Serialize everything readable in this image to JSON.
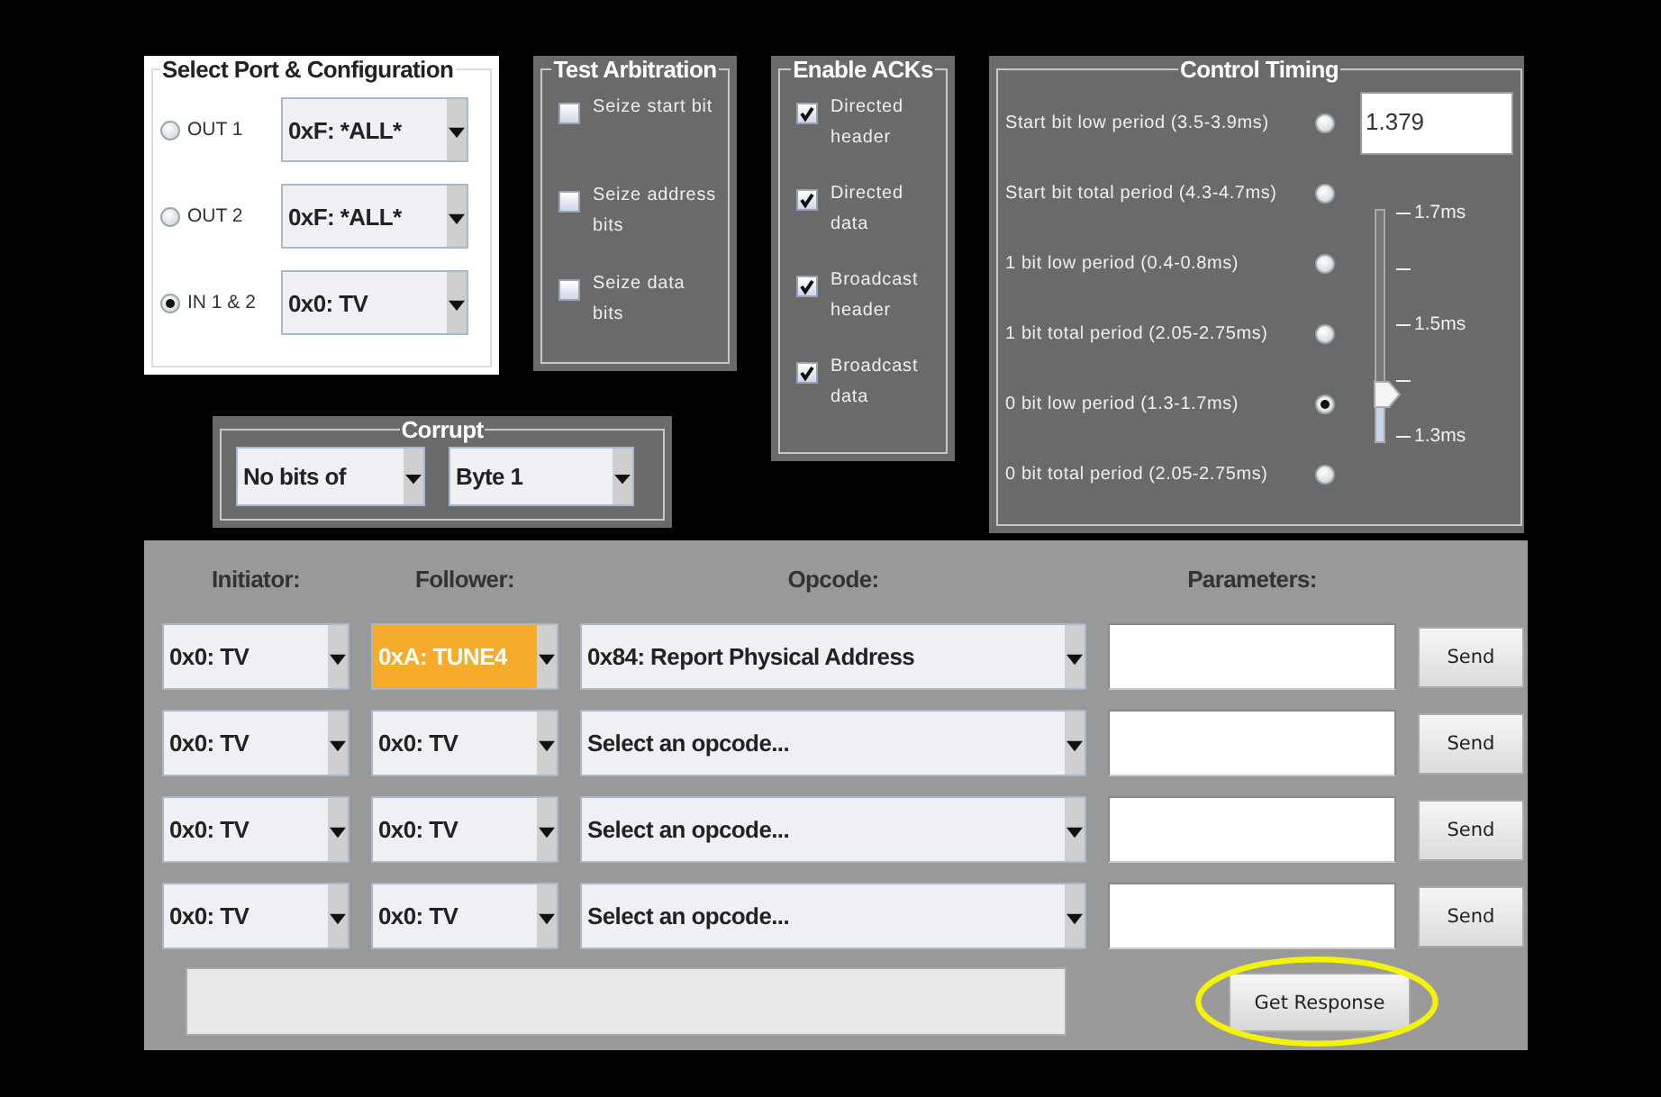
{
  "select_port": {
    "title": "Select Port & Configuration",
    "ports": [
      {
        "label": "OUT 1",
        "selected": false,
        "device": "0xF: *ALL*"
      },
      {
        "label": "OUT 2",
        "selected": false,
        "device": "0xF: *ALL*"
      },
      {
        "label": "IN 1 & 2",
        "selected": true,
        "device": "0x0: TV"
      }
    ]
  },
  "test_arbitration": {
    "title": "Test Arbitration",
    "options": [
      {
        "label": "Seize start bit",
        "checked": false
      },
      {
        "label": "Seize address bits",
        "checked": false
      },
      {
        "label": "Seize data bits",
        "checked": false
      }
    ]
  },
  "enable_acks": {
    "title": "Enable ACKs",
    "options": [
      {
        "label": "Directed header",
        "checked": true
      },
      {
        "label": "Directed data",
        "checked": true
      },
      {
        "label": "Broadcast header",
        "checked": true
      },
      {
        "label": "Broadcast data",
        "checked": true
      }
    ]
  },
  "corrupt": {
    "title": "Corrupt",
    "bits": "No bits of",
    "byte": "Byte 1"
  },
  "control_timing": {
    "title": "Control Timing",
    "value": "1.379",
    "items": [
      {
        "label": "Start bit low period (3.5-3.9ms)",
        "selected": false
      },
      {
        "label": "Start bit total period (4.3-4.7ms)",
        "selected": false
      },
      {
        "label": "1 bit low period (0.4-0.8ms)",
        "selected": false
      },
      {
        "label": "1 bit total period (2.05-2.75ms)",
        "selected": false
      },
      {
        "label": "0 bit low period (1.3-1.7ms)",
        "selected": true
      },
      {
        "label": "0 bit total period (2.05-2.75ms)",
        "selected": false
      }
    ],
    "slider": {
      "level": 0.2,
      "ticks": [
        "1.7ms",
        "1.5ms",
        "1.3ms"
      ]
    }
  },
  "messages": {
    "columns": [
      "Initiator:",
      "Follower:",
      "Opcode:",
      "Parameters:"
    ],
    "rows": [
      {
        "initiator": "0x0: TV",
        "follower": "0xA: TUNE4",
        "follower_highlighted": true,
        "opcode": "0x84: Report Physical Address",
        "send": "Send"
      },
      {
        "initiator": "0x0: TV",
        "follower": "0x0: TV",
        "follower_highlighted": false,
        "opcode": "Select an opcode...",
        "send": "Send"
      },
      {
        "initiator": "0x0: TV",
        "follower": "0x0: TV",
        "follower_highlighted": false,
        "opcode": "Select an opcode...",
        "send": "Send"
      },
      {
        "initiator": "0x0: TV",
        "follower": "0x0: TV",
        "follower_highlighted": false,
        "opcode": "Select an opcode...",
        "send": "Send"
      }
    ],
    "get_response": {
      "label": "Get Response",
      "circled": true
    }
  }
}
